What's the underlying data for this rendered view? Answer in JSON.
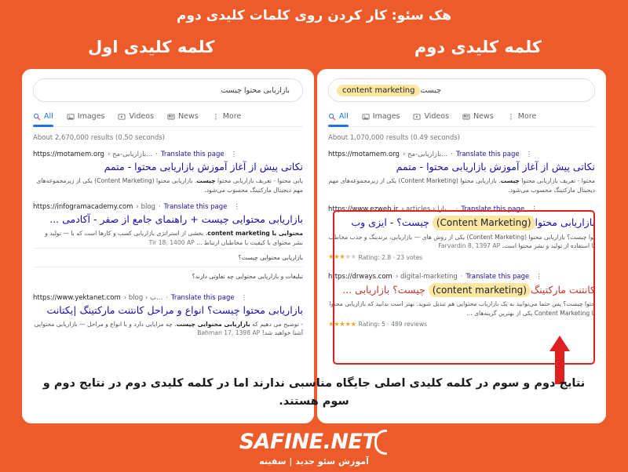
{
  "theme": {
    "orange": "#ED5B2B",
    "link_blue": "#1a0dab",
    "visited_purple": "#681da8",
    "highlight_yellow": "#FBE7A2",
    "red_box": "#E02020",
    "star_on": "#F5A623"
  },
  "header": {
    "main_title": "هک سئو: کار کردن روی کلمات کلیدی دوم",
    "left_column_title": "کلمه کلیدی اول",
    "right_column_title": "کلمه کلیدی دوم"
  },
  "nav_tabs": [
    {
      "label": "All",
      "icon": "search-icon",
      "active": true
    },
    {
      "label": "Images",
      "icon": "image-icon",
      "active": false
    },
    {
      "label": "Videos",
      "icon": "video-icon",
      "active": false
    },
    {
      "label": "News",
      "icon": "news-icon",
      "active": false
    },
    {
      "label": "More",
      "icon": "more-vertical-icon",
      "active": false
    }
  ],
  "left_panel": {
    "search_query": "بازاریابی محتوا چیست",
    "results_count": "About 2,670,000 results (0.50 seconds)",
    "results": [
      {
        "domain": "https://motamem.org",
        "path": "› بازاریابی-مح...",
        "translate": "Translate this page",
        "title": "نکاتی پیش از آغاز آموزش بازاریابی محتوا - متمم",
        "desc_pre": "یابی محتوا - تعریف بازاریابی محتوا ",
        "desc_bold": "چیست",
        "desc_post": ". بازاریابی محتوا (Content Marketing) یکی از زیرمجموعه‌های مهم دیجیتال مارکتینگ محسوب می‌شود."
      },
      {
        "domain": "https://infogramacademy.com",
        "path": "› blog",
        "translate": "Translate this page",
        "title": "بازاریابی محتوایی چیست + راهنمای جامع از صفر - آکادمی ...",
        "date": "Tir 18, 1400 AP",
        "desc_pre": "محتوایی",
        "desc_bold": " یا content marketing",
        "desc_post": "، بخشی از استراتژی بازاریابی کسب و کارها است که با — تولید و نشر محتوای با کیفیت با مخاطبان ارتباط ..."
      },
      {
        "domain": "https://www.yektanet.com",
        "path": "› blog › ب...",
        "translate": "Translate this page",
        "title": "بازاریابی محتوا چیست؟ انواع و مراحل کانتنت مارکتینگ |یکتانت",
        "date": "Bahman 17, 1398 AP",
        "desc_pre": "- توضیح می دهیم که ",
        "desc_bold": "بازاریابی محتوایی چیست",
        "desc_post": ". چه مزایایی دارد و با انواع و مراحل — بازاریابی محتوایی آشنا خواهید شد!"
      }
    ],
    "related_questions": [
      "بازاریابی محتوایی چیست؟",
      "تبلیغات و بازاریابی محتوایی چه تفاوتی دارند؟"
    ]
  },
  "right_panel": {
    "search_query_highlight": "content marketing",
    "search_query_suffix": "چیست",
    "results_count": "About 1,070,000 results (0.49 seconds)",
    "results": [
      {
        "domain": "https://motamem.org",
        "path": "› بازاریابی-مح...",
        "translate": "Translate this page",
        "title": "نکاتی پیش از آغاز آموزش بازاریابی محتوا - متمم",
        "desc_pre": "محتوا - تعریف بازاریابی محتوا ",
        "desc_bold": "چیست",
        "desc_post": ". بازاریابی محتوا (Content Marketing) یکی از زیرمجموعه‌های مهم دیجیتال مارکتینگ محسوب می‌شود.",
        "in_red_box": false
      },
      {
        "domain": "https://www.ezweb.ir",
        "path": "› articles › بازا...",
        "translate": "Translate this page",
        "title_right": "بازاریابی محتوا",
        "title_highlight": "(Content Marketing)",
        "title_left": "چیست؟ - ایزی وب",
        "date": "Farvardin 8, 1397 AP",
        "desc": "توا چیست؟ بازاریابی محتوا (Content Marketing) یکی از روش های — بازاریابی، برندینگ و جذب مخاطب با استفاده از تولید و نشر محتوا است.",
        "rating_stars_on": 3,
        "rating_stars_off": 2,
        "rating_text": "Rating: 2.8 · 23 votes",
        "in_red_box": true
      },
      {
        "domain": "https://drways.com",
        "path": "› digital-marketing",
        "translate": "Translate this page",
        "title_right": "کانتنت مارکتینگ",
        "title_highlight": "(content marketing)",
        "title_left": "چیست؟ بازاریابی ...",
        "desc": "حتوا چیست؟ پس حتما می‌توانید به یک بازاریاب محتوایی هم تبدیل شوید. بهتر است بدانید که بازاریابی محتوا یا Content Marketing یکی از بهترین گزینه‌های ...",
        "rating_stars_on": 5,
        "rating_stars_off": 0,
        "rating_text": "Rating: 5 · 489 reviews",
        "in_red_box": true
      }
    ]
  },
  "caption": "نتایج دوم و سوم در کلمه کلیدی اصلی جایگاه مناسبی ندارند اما در کلمه کلیدی دوم در نتایج دوم و سوم هستند.",
  "footer": {
    "logo_text": "SAFINE.NET",
    "tagline": "آموزش سئو جدید | سفینه"
  }
}
